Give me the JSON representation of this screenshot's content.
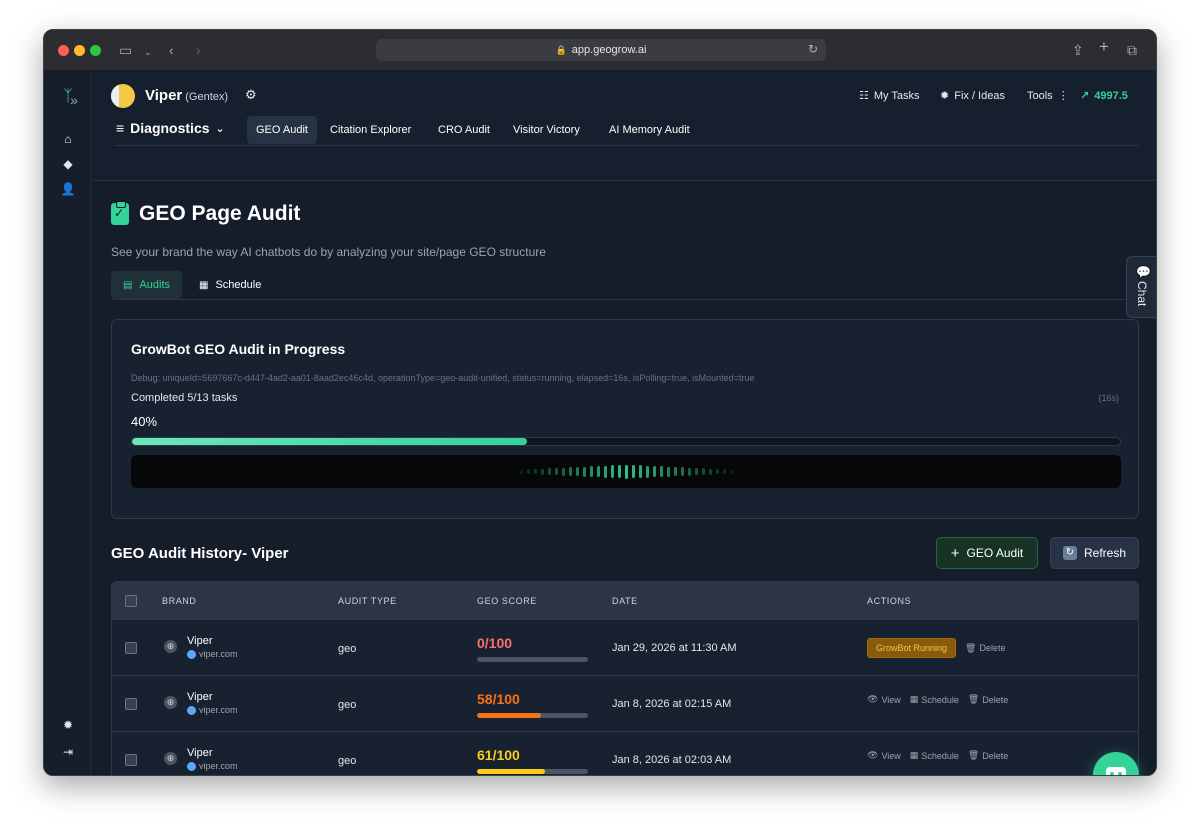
{
  "browser": {
    "url": "app.geogrow.ai",
    "lock_icon": "lock-icon"
  },
  "header": {
    "brand_name": "Viper",
    "brand_sub": "(Gentex)",
    "my_tasks": "My Tasks",
    "fix_ideas": "Fix / Ideas",
    "tools": "Tools",
    "credits": "4997.5",
    "section": "Diagnostics",
    "tabs": [
      "GEO Audit",
      "Citation Explorer",
      "CRO Audit",
      "Visitor Victory",
      "AI Memory Audit"
    ],
    "active_tab": "GEO Audit"
  },
  "page": {
    "title": "GEO Page Audit",
    "subtitle": "See your brand the way AI chatbots do by analyzing your site/page GEO structure",
    "tabs": [
      "Audits",
      "Schedule"
    ]
  },
  "progress": {
    "title": "GrowBot GEO Audit in Progress",
    "debug": "Debug: uniqueId=5697667c-d447-4ad2-aa01-8aad2ec46c4d, operationType=geo-audit-unified, status=running, elapsed=16s, isPolling=true, isMounted=true",
    "status": "Completed 5/13 tasks",
    "elapsed": "(16s)",
    "percent_label": "40%",
    "percent": 40
  },
  "history": {
    "title": "GEO Audit History- Viper",
    "add_button": "GEO Audit",
    "refresh_button": "Refresh",
    "columns": [
      "BRAND",
      "AUDIT TYPE",
      "GEO SCORE",
      "DATE",
      "ACTIONS"
    ],
    "rows": [
      {
        "brand": "Viper",
        "site": "viper.com",
        "type": "geo",
        "score": "0/100",
        "score_value": 0,
        "score_color": "#f87171",
        "date": "Jan 29, 2026 at 11:30 AM",
        "status": "GrowBot Running",
        "delete": "Delete"
      },
      {
        "brand": "Viper",
        "site": "viper.com",
        "type": "geo",
        "score": "58/100",
        "score_value": 58,
        "score_color": "#f97316",
        "date": "Jan 8, 2026 at 02:15 AM",
        "view": "View",
        "schedule": "Schedule",
        "delete": "Delete"
      },
      {
        "brand": "Viper",
        "site": "viper.com",
        "type": "geo",
        "score": "61/100",
        "score_value": 61,
        "score_color": "#facc15",
        "date": "Jan 8, 2026 at 02:03 AM",
        "view": "View",
        "schedule": "Schedule",
        "delete": "Delete"
      }
    ]
  },
  "chat_tab": "Chat",
  "colors": {
    "accent": "#34d399",
    "background": "#111827"
  }
}
